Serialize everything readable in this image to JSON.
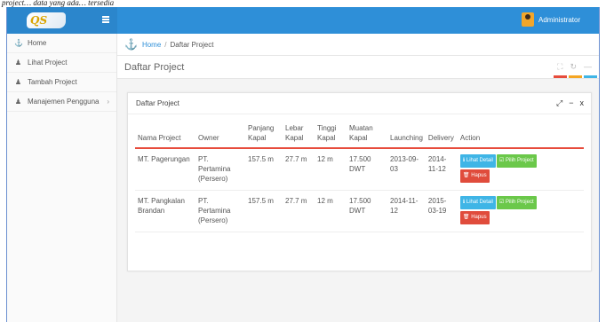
{
  "caption": "project… data yang ada… tersedia",
  "header": {
    "logo_text": "QS",
    "user_name": "Administrator",
    "accent_color": "#2e8fd8"
  },
  "sidebar": {
    "items": [
      {
        "label": "Home",
        "icon": "anchor-icon"
      },
      {
        "label": "Lihat Project",
        "icon": "user-icon"
      },
      {
        "label": "Tambah Project",
        "icon": "user-icon"
      },
      {
        "label": "Manajemen Pengguna",
        "icon": "user-icon",
        "has_submenu": true
      }
    ]
  },
  "breadcrumb": {
    "home": "Home",
    "separator": "/",
    "current": "Daftar Project"
  },
  "page": {
    "title": "Daftar Project",
    "accent_colors": [
      "#e74c3c",
      "#f5a623",
      "#3fb5e6"
    ]
  },
  "panel": {
    "title": "Daftar Project",
    "columns": [
      "Nama Project",
      "Owner",
      "Panjang Kapal",
      "Lebar Kapal",
      "Tinggi Kapal",
      "Muatan Kapal",
      "Launching",
      "Delivery",
      "Action"
    ],
    "rows": [
      {
        "nama": "MT. Pagerungan",
        "owner": "PT. Pertamina (Persero)",
        "panjang": "157.5 m",
        "lebar": "27.7 m",
        "tinggi": "12 m",
        "muatan": "17.500 DWT",
        "launching": "2013-09-03",
        "delivery": "2014-11-12"
      },
      {
        "nama": "MT. Pangkalan Brandan",
        "owner": "PT. Pertamina (Persero)",
        "panjang": "157.5 m",
        "lebar": "27.7 m",
        "tinggi": "12 m",
        "muatan": "17.500 DWT",
        "launching": "2014-11-12",
        "delivery": "2015-03-19"
      }
    ],
    "actions": {
      "detail": "Lihat Detail",
      "pilih": "Pilih Project",
      "hapus": "Hapus"
    }
  }
}
